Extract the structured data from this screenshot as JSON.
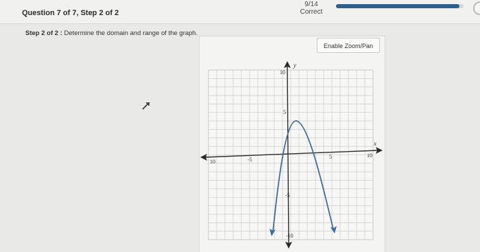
{
  "header": {
    "question_title": "Question 7 of 7, Step 2 of 2",
    "score": "9/14",
    "status": "Correct",
    "progress_fraction": 0.97
  },
  "prompt": {
    "step_label": "Step 2 of 2 :",
    "text": "Determine the domain and range of the graph."
  },
  "graph": {
    "zoom_button_label": "Enable Zoom/Pan",
    "x_axis_label": "x",
    "y_axis_label": "y",
    "tick_labels": {
      "x_neg10": "10",
      "x_neg5": "-5",
      "x_pos5": "5",
      "x_pos10": "10",
      "y_pos10": "10",
      "y_pos5": "5",
      "y_neg5": "-5",
      "y_neg10": "-10"
    }
  },
  "colors": {
    "curve": "#3f6da0",
    "progress": "#2d5f8c"
  }
}
